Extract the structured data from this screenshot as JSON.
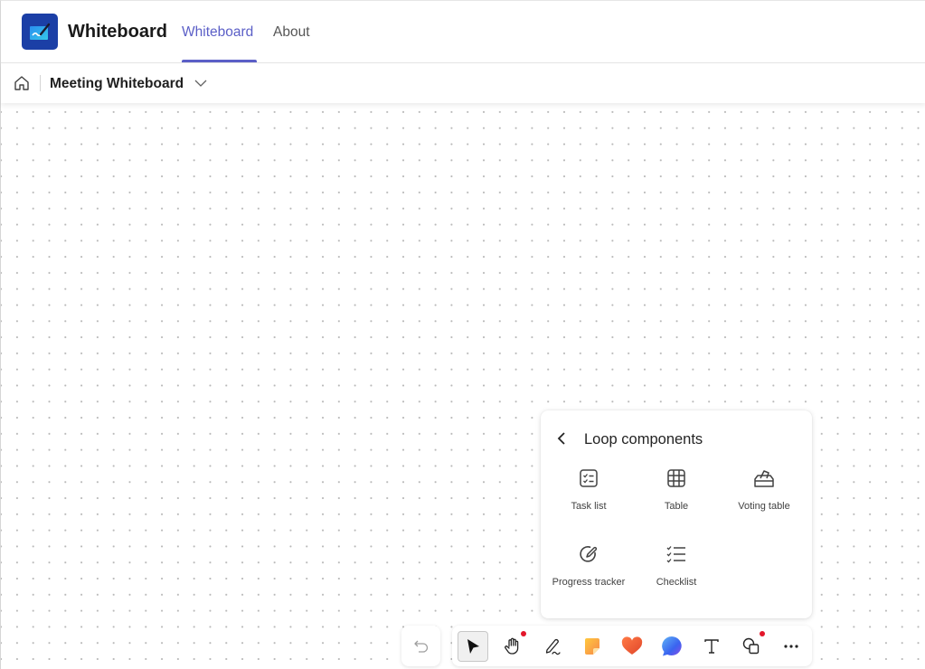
{
  "app": {
    "title": "Whiteboard",
    "logo_icon": "whiteboard-app-logo",
    "accent_color": "#5b5fc7",
    "tabs": [
      {
        "label": "Whiteboard",
        "active": true
      },
      {
        "label": "About",
        "active": false
      }
    ]
  },
  "breadcrumb": {
    "home_icon": "home-icon",
    "board_name": "Meeting Whiteboard",
    "dropdown_icon": "chevron-down-icon"
  },
  "loop_panel": {
    "title": "Loop components",
    "back_icon": "chevron-left-icon",
    "components": [
      {
        "label": "Task list",
        "icon": "task-list-icon"
      },
      {
        "label": "Table",
        "icon": "table-icon"
      },
      {
        "label": "Voting table",
        "icon": "voting-table-icon"
      },
      {
        "label": "Progress tracker",
        "icon": "progress-tracker-icon"
      },
      {
        "label": "Checklist",
        "icon": "checklist-icon"
      }
    ]
  },
  "toolbar": {
    "undo_icon": "undo-icon",
    "tools": [
      {
        "name": "Select",
        "icon": "pointer-icon",
        "selected": true,
        "notification": false
      },
      {
        "name": "Pan",
        "icon": "hand-icon",
        "selected": false,
        "notification": true
      },
      {
        "name": "Pen",
        "icon": "pen-icon",
        "selected": false,
        "notification": false
      },
      {
        "name": "Sticky note",
        "icon": "sticky-note-icon",
        "selected": false,
        "notification": false
      },
      {
        "name": "Reactions",
        "icon": "heart-icon",
        "selected": false,
        "notification": false
      },
      {
        "name": "Comment",
        "icon": "comment-icon",
        "selected": false,
        "notification": false
      },
      {
        "name": "Text",
        "icon": "text-icon",
        "selected": false,
        "notification": false
      },
      {
        "name": "Shapes",
        "icon": "shapes-icon",
        "selected": false,
        "notification": true
      },
      {
        "name": "More options",
        "icon": "more-icon",
        "selected": false,
        "notification": false
      }
    ],
    "notification_color": "#e3162a"
  }
}
